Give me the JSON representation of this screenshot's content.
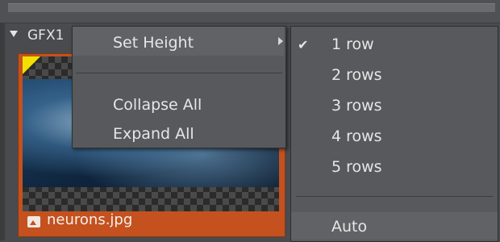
{
  "group": {
    "label": "GFX1"
  },
  "thumbnail": {
    "filename": "neurons.jpg",
    "file_icon": "image-icon"
  },
  "context_menu": {
    "items": [
      {
        "label": "Set Height",
        "has_submenu": true
      },
      {
        "label": "Collapse All"
      },
      {
        "label": "Expand All"
      }
    ]
  },
  "height_submenu": {
    "items": [
      {
        "label": "1 row",
        "checked": true
      },
      {
        "label": "2 rows"
      },
      {
        "label": "3 rows"
      },
      {
        "label": "4 rows"
      },
      {
        "label": "5 rows"
      },
      {
        "label": "Auto"
      }
    ],
    "check_glyph": "✔"
  }
}
